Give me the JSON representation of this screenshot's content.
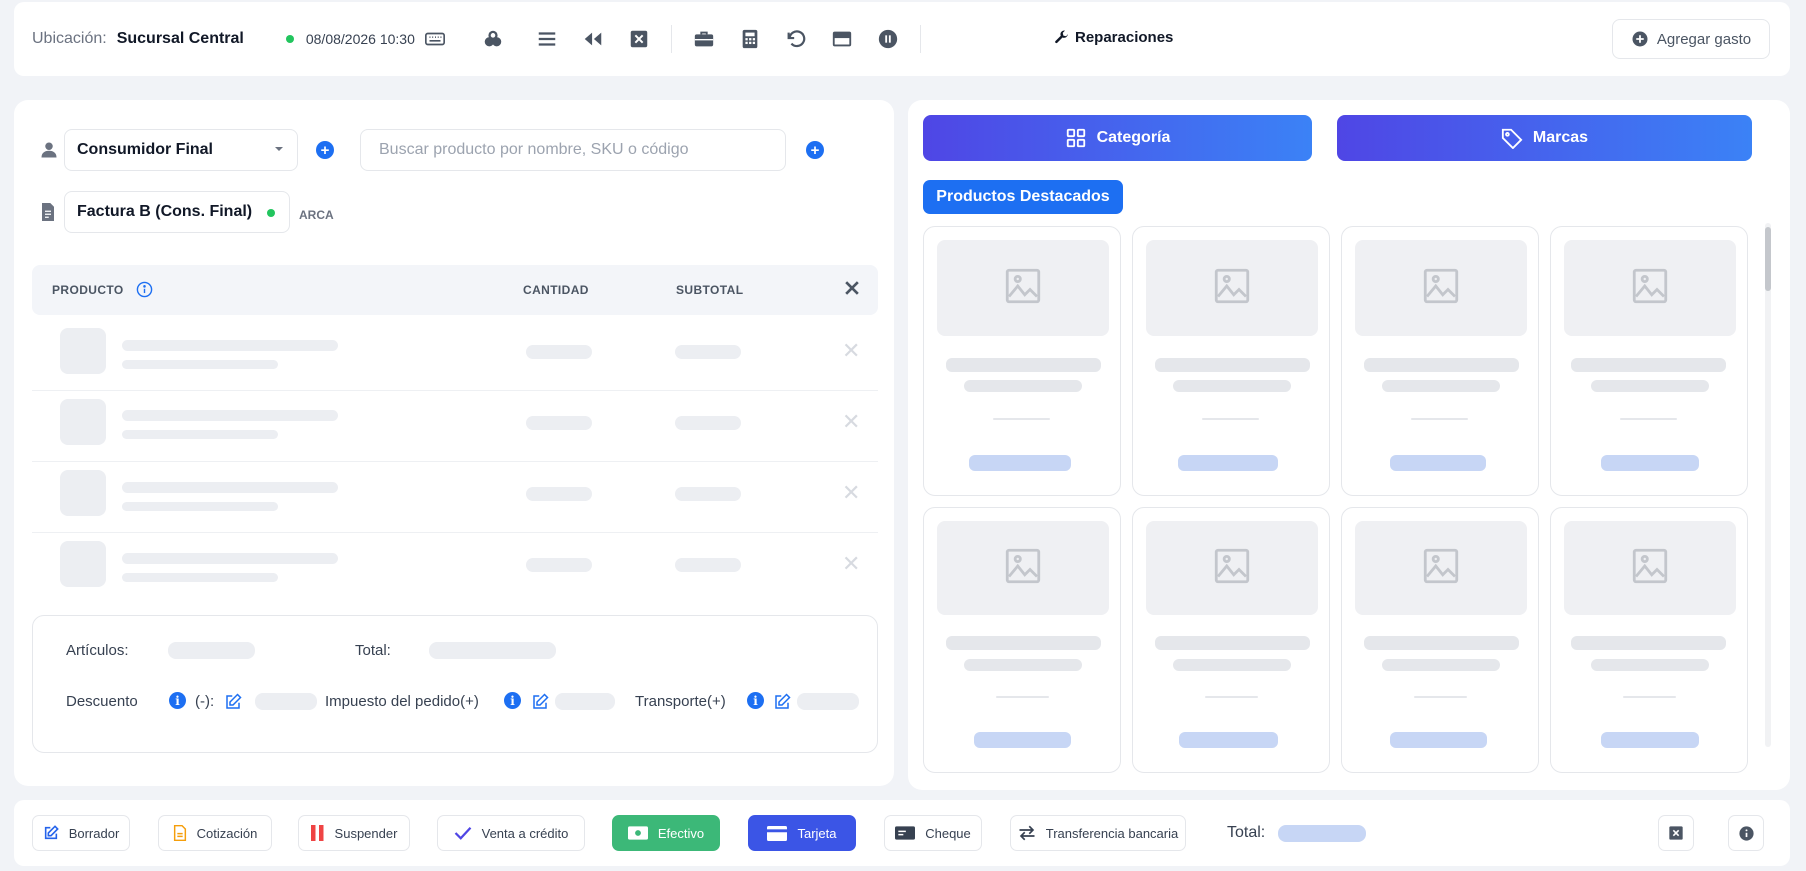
{
  "topbar": {
    "location_label": "Ubicación:",
    "location_value": "Sucursal Central",
    "datetime": "08/08/2026 10:30",
    "repair_label": "Reparaciones",
    "add_expense_label": "Agregar gasto",
    "icons": [
      "keyboard-icon",
      "coins-icon",
      "list-icon",
      "rewind-icon",
      "close-square-icon",
      "briefcase-icon",
      "calculator-icon",
      "undo-icon",
      "window-icon",
      "pause-icon",
      "wrench-icon",
      "plus-circle-icon"
    ]
  },
  "left": {
    "customer_select": "Consumidor Final",
    "search_placeholder": "Buscar producto por nombre, SKU o código",
    "invoice_select": "Factura B (Cons. Final)",
    "arca_label": "ARCA",
    "table": {
      "headers": {
        "product": "PRODUCTO",
        "quantity": "CANTIDAD",
        "subtotal": "SUBTOTAL"
      }
    },
    "summary": {
      "items_label": "Artículos:",
      "total_label": "Total:",
      "discount_label": "Descuento",
      "discount_sign": "(-):",
      "tax_label": "Impuesto del pedido(+)",
      "shipping_label": "Transporte(+)"
    }
  },
  "right": {
    "category_label": "Categoría",
    "brands_label": "Marcas",
    "featured_label": "Productos Destacados"
  },
  "bottombar": {
    "draft": "Borrador",
    "quote": "Cotización",
    "suspend": "Suspender",
    "credit_sale": "Venta a crédito",
    "cash": "Efectivo",
    "card": "Tarjeta",
    "cheque": "Cheque",
    "transfer": "Transferencia bancaria",
    "total_label": "Total:"
  },
  "colors": {
    "accent": "#1d6ff2",
    "gradient_start": "#4f46e5",
    "gradient_end": "#3b82f6",
    "cash_green": "#3cb878",
    "card_blue": "#3b55e6",
    "status_dot": "#22c55e"
  }
}
